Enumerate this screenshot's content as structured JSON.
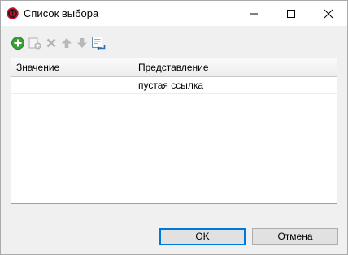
{
  "window": {
    "title": "Список выбора",
    "app_icon": "1c-logo-icon"
  },
  "title_buttons": {
    "minimize": "minimize-icon",
    "maximize": "maximize-icon",
    "close": "close-icon"
  },
  "toolbar": {
    "buttons": [
      {
        "name": "add",
        "icon": "add-icon",
        "enabled": true
      },
      {
        "name": "copy",
        "icon": "copy-icon",
        "enabled": false
      },
      {
        "name": "delete",
        "icon": "delete-icon",
        "enabled": false
      },
      {
        "name": "move-up",
        "icon": "arrow-up-icon",
        "enabled": false
      },
      {
        "name": "move-down",
        "icon": "arrow-down-icon",
        "enabled": false
      },
      {
        "name": "fill",
        "icon": "fill-list-icon",
        "enabled": true
      }
    ]
  },
  "table": {
    "columns": [
      "Значение",
      "Представление"
    ],
    "rows": [
      {
        "value": "",
        "representation": "пустая ссылка"
      }
    ]
  },
  "buttons": {
    "ok_label": "OK",
    "cancel_label": "Отмена"
  },
  "colors": {
    "accent": "#0078d7",
    "add_green": "#3aa13a",
    "app_icon_red": "#c8102e"
  }
}
